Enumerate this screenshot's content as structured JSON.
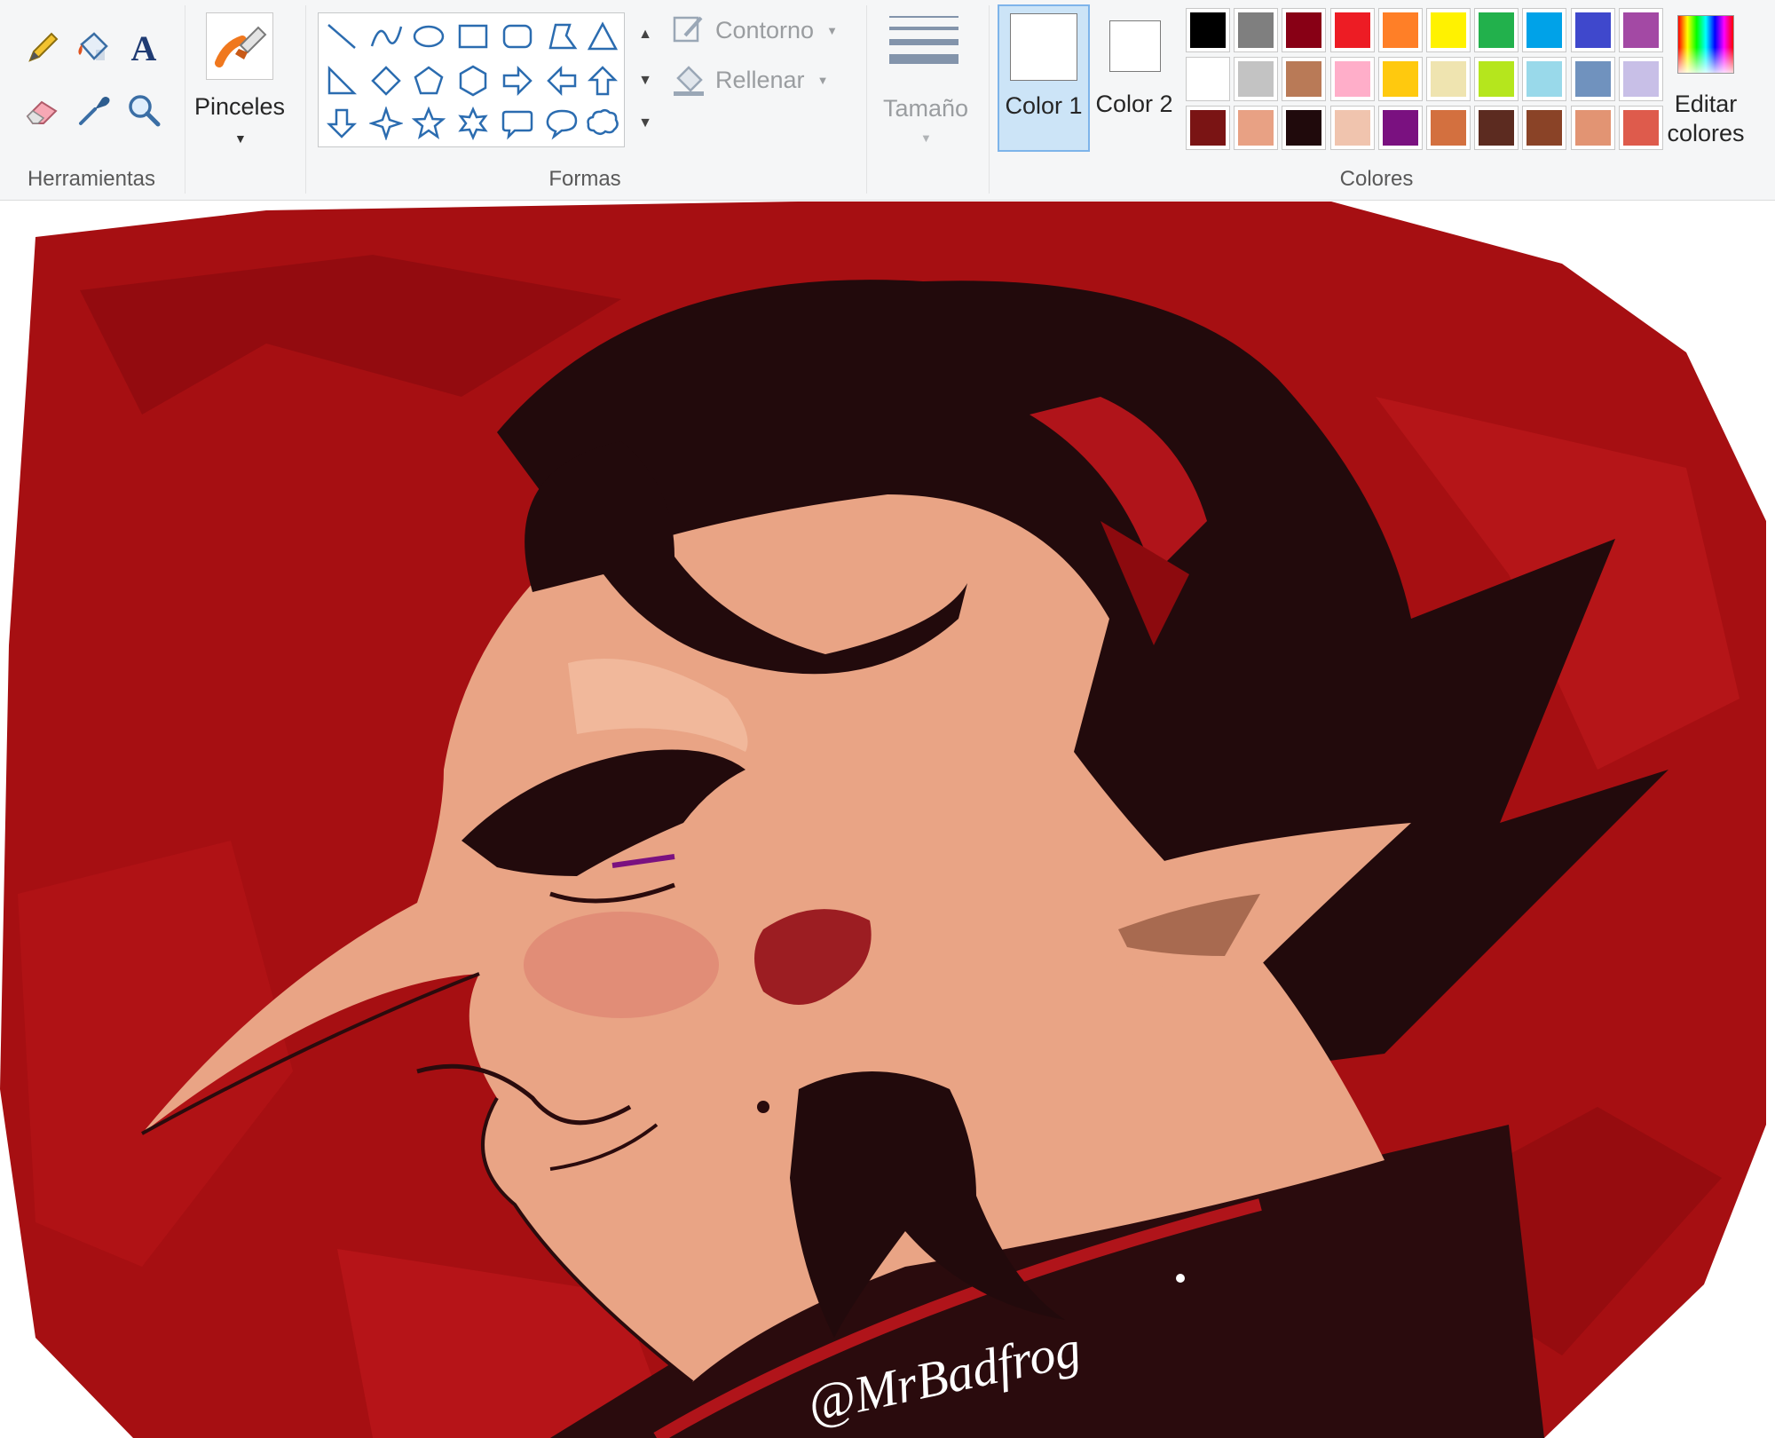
{
  "ribbon": {
    "groups": {
      "tools": "Herramientas",
      "shapes": "Formas",
      "colors": "Colores"
    },
    "brushes_label": "Pinceles",
    "outline_label": "Contorno",
    "fill_label": "Rellenar",
    "size_label": "Tamaño",
    "color1_label": "Color 1",
    "color2_label": "Color 2",
    "edit_colors_label": "Editar colores"
  },
  "tools": [
    "pencil-icon",
    "fill-bucket-icon",
    "text-icon",
    "eraser-icon",
    "color-picker-icon",
    "magnifier-icon"
  ],
  "shapes": [
    "line",
    "curve",
    "oval",
    "rectangle",
    "rounded-rectangle",
    "polygon",
    "triangle",
    "right-triangle",
    "diamond",
    "pentagon",
    "hexagon",
    "right-arrow",
    "left-arrow",
    "up-arrow",
    "down-arrow",
    "four-point-star",
    "five-point-star",
    "six-point-star",
    "rounded-callout",
    "oval-callout",
    "cloud-callout"
  ],
  "palette": {
    "row1": [
      "#000000",
      "#7f7f7f",
      "#880015",
      "#ed1c24",
      "#ff7f27",
      "#fff200",
      "#22b14c",
      "#00a2e8",
      "#3f48cc",
      "#a349a4"
    ],
    "row2": [
      "#ffffff",
      "#c3c3c3",
      "#b97a57",
      "#ffaec9",
      "#ffc90e",
      "#efe4b0",
      "#b5e61d",
      "#99d9ea",
      "#7092be",
      "#c8bfe7"
    ],
    "row3": [
      "#7a1414",
      "#e8a184",
      "#200a0c",
      "#f0c4ae",
      "#7a1180",
      "#d3703f",
      "#5c2b20",
      "#8a4327",
      "#e29473",
      "#de5b4c"
    ]
  },
  "color1": "#ffffff",
  "color2": "#ffffff",
  "artwork": {
    "background_red": "#a60f12",
    "signature": "@MrBadfrog"
  }
}
